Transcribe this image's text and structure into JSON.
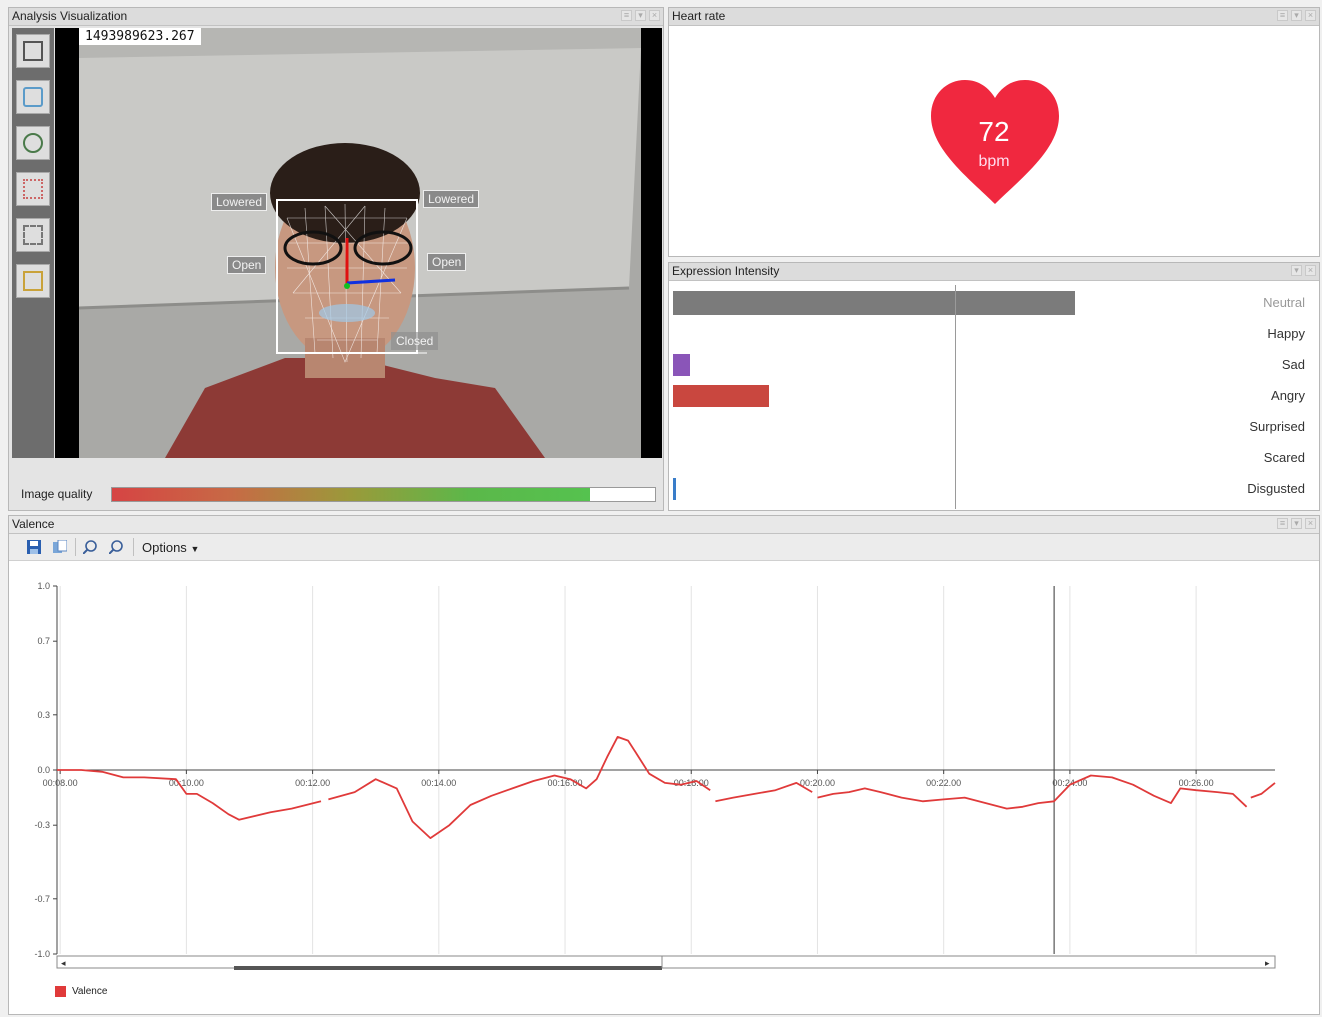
{
  "analysis": {
    "title": "Analysis Visualization",
    "timestamp": "1493989623.267",
    "face_labels": {
      "brow_left": "Lowered",
      "brow_right": "Lowered",
      "eye_left": "Open",
      "eye_right": "Open",
      "mouth": "Closed"
    },
    "image_quality_label": "Image quality",
    "image_quality_level": 0.88,
    "tools": [
      "frame-icon",
      "face-mesh-icon",
      "face-mask-icon",
      "face-points-icon",
      "face-grid-icon",
      "face-box-icon"
    ]
  },
  "heart_rate": {
    "title": "Heart rate",
    "value": "72",
    "unit": "bpm",
    "color": "#f0283f"
  },
  "expression": {
    "title": "Expression Intensity",
    "items": [
      {
        "label": "Neutral",
        "value": 0.71,
        "color": "#7b7b7b"
      },
      {
        "label": "Happy",
        "value": 0.0,
        "color": "#e3a83a"
      },
      {
        "label": "Sad",
        "value": 0.03,
        "color": "#8a55b8"
      },
      {
        "label": "Angry",
        "value": 0.17,
        "color": "#c9473f"
      },
      {
        "label": "Surprised",
        "value": 0.0,
        "color": "#4aa8d8"
      },
      {
        "label": "Scared",
        "value": 0.0,
        "color": "#3ab3a0"
      },
      {
        "label": "Disgusted",
        "value": 0.005,
        "color": "#3a7dc9"
      }
    ]
  },
  "valence": {
    "title": "Valence",
    "options_label": "Options",
    "legend_label": "Valence"
  },
  "chart_data": {
    "type": "line",
    "title": "Valence",
    "xlabel": "",
    "ylabel": "",
    "x_unit": "seconds",
    "xlim": [
      477,
      1635
    ],
    "ylim": [
      -1.0,
      1.0
    ],
    "yticks": [
      1.0,
      0.7,
      0.3,
      0.0,
      -0.3,
      -0.7,
      -1.0
    ],
    "ytick_labels": [
      "1.0",
      "0.7",
      "0.3",
      "0.0",
      "-0.3",
      "-0.7",
      "-1.0"
    ],
    "xticks": [
      480,
      600,
      720,
      840,
      960,
      1080,
      1200,
      1320,
      1440,
      1560
    ],
    "xtick_labels": [
      "00:08.00",
      "00:10.00",
      "00:12.00",
      "00:14.00",
      "00:16.00",
      "00:18.00",
      "00:20.00",
      "00:22.00",
      "00:24.00",
      "00:26.00"
    ],
    "cursor_x": 1425,
    "grid": true,
    "series": [
      {
        "name": "Valence",
        "color": "#e03a3a",
        "segments": [
          [
            [
              477,
              0.0
            ],
            [
              500,
              0.0
            ],
            [
              520,
              -0.01
            ],
            [
              540,
              -0.04
            ],
            [
              560,
              -0.04
            ],
            [
              590,
              -0.05
            ],
            [
              600,
              -0.13
            ],
            [
              610,
              -0.13
            ],
            [
              625,
              -0.18
            ],
            [
              640,
              -0.24
            ],
            [
              650,
              -0.27
            ],
            [
              680,
              -0.23
            ],
            [
              700,
              -0.21
            ],
            [
              728,
              -0.17
            ]
          ],
          [
            [
              735,
              -0.16
            ],
            [
              760,
              -0.12
            ],
            [
              780,
              -0.05
            ],
            [
              800,
              -0.1
            ],
            [
              815,
              -0.28
            ],
            [
              832,
              -0.37
            ],
            [
              850,
              -0.3
            ],
            [
              870,
              -0.19
            ],
            [
              890,
              -0.14
            ],
            [
              910,
              -0.1
            ],
            [
              930,
              -0.06
            ],
            [
              950,
              -0.03
            ],
            [
              965,
              -0.05
            ],
            [
              980,
              -0.1
            ],
            [
              990,
              -0.05
            ],
            [
              1000,
              0.07
            ],
            [
              1010,
              0.18
            ],
            [
              1020,
              0.16
            ],
            [
              1030,
              0.07
            ],
            [
              1040,
              -0.02
            ],
            [
              1055,
              -0.07
            ],
            [
              1070,
              -0.08
            ],
            [
              1085,
              -0.06
            ],
            [
              1098,
              -0.11
            ]
          ],
          [
            [
              1103,
              -0.17
            ],
            [
              1120,
              -0.15
            ],
            [
              1140,
              -0.13
            ],
            [
              1160,
              -0.11
            ],
            [
              1180,
              -0.07
            ],
            [
              1195,
              -0.12
            ]
          ],
          [
            [
              1200,
              -0.15
            ],
            [
              1215,
              -0.13
            ],
            [
              1230,
              -0.12
            ],
            [
              1245,
              -0.1
            ],
            [
              1260,
              -0.12
            ],
            [
              1280,
              -0.15
            ],
            [
              1300,
              -0.17
            ],
            [
              1320,
              -0.16
            ],
            [
              1340,
              -0.15
            ],
            [
              1360,
              -0.18
            ],
            [
              1380,
              -0.21
            ],
            [
              1395,
              -0.2
            ],
            [
              1410,
              -0.18
            ],
            [
              1425,
              -0.17
            ],
            [
              1440,
              -0.08
            ],
            [
              1460,
              -0.03
            ],
            [
              1480,
              -0.04
            ],
            [
              1500,
              -0.08
            ],
            [
              1520,
              -0.14
            ],
            [
              1536,
              -0.18
            ],
            [
              1545,
              -0.1
            ],
            [
              1560,
              -0.11
            ],
            [
              1580,
              -0.12
            ],
            [
              1595,
              -0.13
            ],
            [
              1608,
              -0.2
            ]
          ],
          [
            [
              1612,
              -0.15
            ],
            [
              1622,
              -0.13
            ],
            [
              1635,
              -0.07
            ]
          ]
        ]
      }
    ]
  }
}
